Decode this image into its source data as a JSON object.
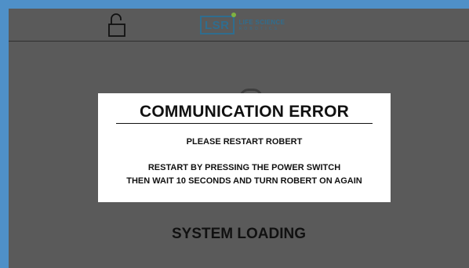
{
  "header": {
    "lock_icon": "unlocked-padlock-icon",
    "logo": {
      "mark": "LSR",
      "line1": "LIFE SCIENCE",
      "line2": "ROBOTICS",
      "accent_color": "#7fb241",
      "brand_color": "#2f6d8f"
    }
  },
  "dialog": {
    "title": "COMMUNICATION ERROR",
    "message": "PLEASE RESTART ROBERT",
    "instruction_line1": "RESTART BY PRESSING THE POWER SWITCH",
    "instruction_line2": "THEN WAIT 10 SECONDS AND TURN ROBERT ON AGAIN"
  },
  "status": {
    "loading_text": "SYSTEM LOADING"
  },
  "colors": {
    "frame": "#4f90c8",
    "background": "#5a5a5a",
    "dialog": "#ffffff"
  }
}
